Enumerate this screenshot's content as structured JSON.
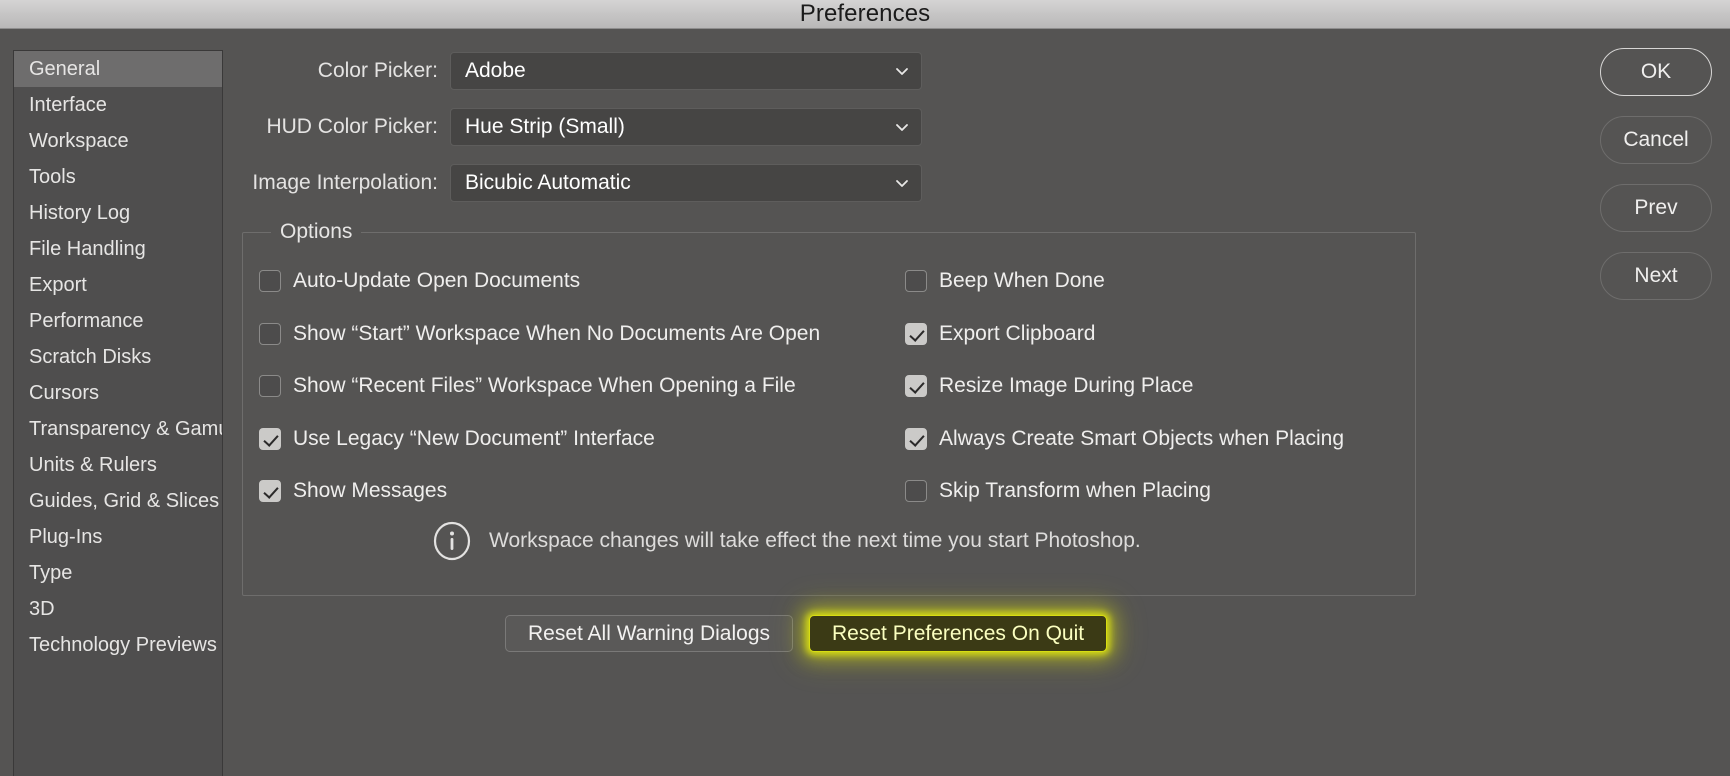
{
  "window": {
    "title": "Preferences"
  },
  "sidebar": {
    "items": [
      {
        "label": "General",
        "selected": true
      },
      {
        "label": "Interface",
        "selected": false
      },
      {
        "label": "Workspace",
        "selected": false
      },
      {
        "label": "Tools",
        "selected": false
      },
      {
        "label": "History Log",
        "selected": false
      },
      {
        "label": "File Handling",
        "selected": false
      },
      {
        "label": "Export",
        "selected": false
      },
      {
        "label": "Performance",
        "selected": false
      },
      {
        "label": "Scratch Disks",
        "selected": false
      },
      {
        "label": "Cursors",
        "selected": false
      },
      {
        "label": "Transparency & Gamut",
        "selected": false
      },
      {
        "label": "Units & Rulers",
        "selected": false
      },
      {
        "label": "Guides, Grid & Slices",
        "selected": false
      },
      {
        "label": "Plug-Ins",
        "selected": false
      },
      {
        "label": "Type",
        "selected": false
      },
      {
        "label": "3D",
        "selected": false
      },
      {
        "label": "Technology Previews",
        "selected": false
      }
    ]
  },
  "fields": [
    {
      "label": "Color Picker:",
      "value": "Adobe",
      "icon": "chevron-down-icon"
    },
    {
      "label": "HUD Color Picker:",
      "value": "Hue Strip (Small)",
      "icon": "chevron-down-icon"
    },
    {
      "label": "Image Interpolation:",
      "value": "Bicubic Automatic",
      "icon": "chevron-down-icon"
    }
  ],
  "options": {
    "legend": "Options",
    "left_column": [
      {
        "label": "Auto-Update Open Documents",
        "checked": false
      },
      {
        "label": "Show “Start” Workspace When No Documents Are Open",
        "checked": false
      },
      {
        "label": "Show “Recent Files” Workspace When Opening a File",
        "checked": false
      },
      {
        "label": "Use Legacy “New Document” Interface",
        "checked": true
      },
      {
        "label": "Show Messages",
        "checked": true
      }
    ],
    "right_column": [
      {
        "label": "Beep When Done",
        "checked": false
      },
      {
        "label": "Export Clipboard",
        "checked": true
      },
      {
        "label": "Resize Image During Place",
        "checked": true
      },
      {
        "label": "Always Create Smart Objects when Placing",
        "checked": true
      },
      {
        "label": "Skip Transform when Placing",
        "checked": false
      }
    ],
    "info": {
      "icon": "info-circle-icon",
      "text": "Workspace changes will take effect the next time you start Photoshop."
    }
  },
  "bottom_buttons": [
    {
      "label": "Reset All Warning Dialogs",
      "highlighted": false
    },
    {
      "label": "Reset Preferences On Quit",
      "highlighted": true
    }
  ],
  "side_buttons": [
    {
      "label": "OK",
      "primary": true
    },
    {
      "label": "Cancel",
      "primary": false
    },
    {
      "label": "Prev",
      "primary": false
    },
    {
      "label": "Next",
      "primary": false
    }
  ],
  "colors": {
    "dialog_bg": "#555453",
    "sidebar_bg": "#4f4e4e",
    "selected_bg": "#6e6d6d",
    "highlight_glow": "#d8dd12",
    "titlebar_text": "#1b1b1b"
  }
}
